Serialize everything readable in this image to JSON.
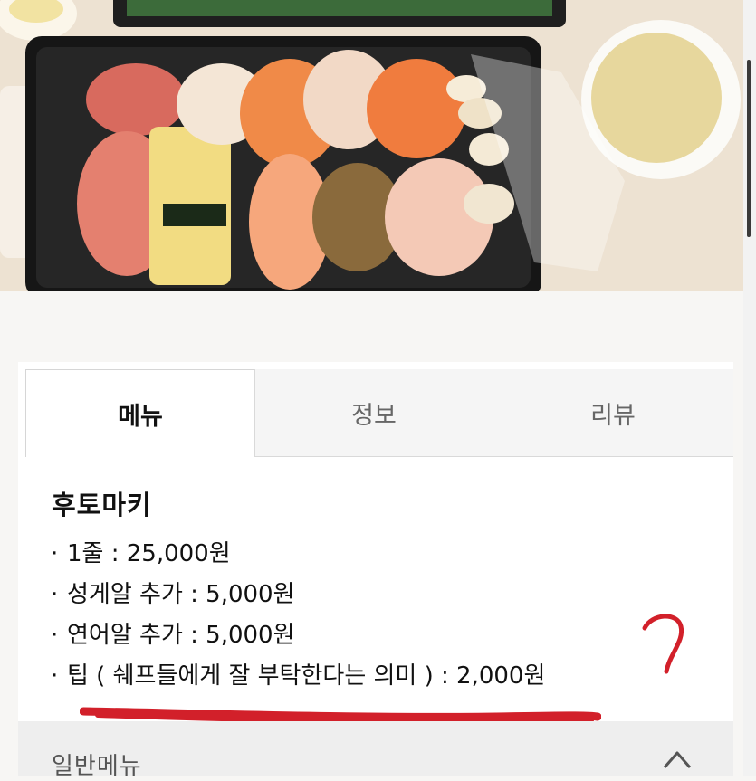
{
  "tabs": [
    {
      "label": "메뉴",
      "active": true
    },
    {
      "label": "정보",
      "active": false
    },
    {
      "label": "리뷰",
      "active": false
    }
  ],
  "section": {
    "title": "후토마키",
    "items": [
      "1줄 : 25,000원",
      "성게알 추가 : 5,000원",
      "연어알 추가 : 5,000원",
      "팁 ( 쉐프들에게 잘 부탁한다는 의미 ) : 2,000원"
    ],
    "bullet": "·"
  },
  "footer": {
    "label": "일반메뉴"
  },
  "annotation": {
    "mark": "?",
    "color": "#d2202a"
  },
  "icons": {
    "collapse": "chevron-up-icon"
  }
}
